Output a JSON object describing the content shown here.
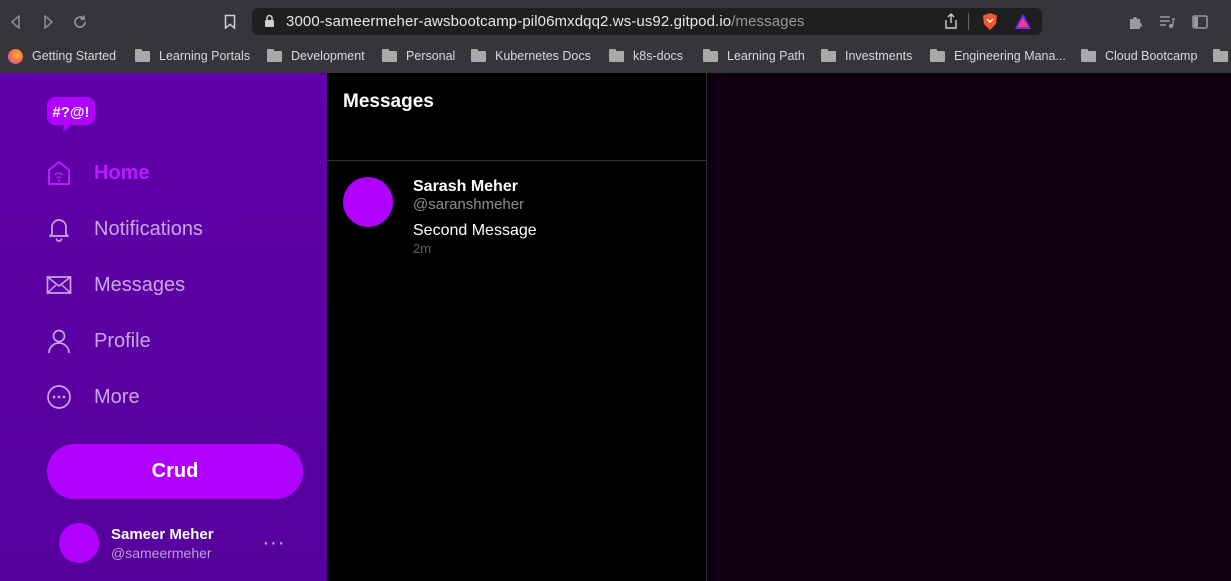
{
  "browser": {
    "url_host": "3000-sameermeher-awsbootcamp-pil06mxdqq2.ws-us92.gitpod.io",
    "url_path": "/messages",
    "bookmarks": [
      "Getting Started",
      "Learning Portals",
      "Development",
      "Personal",
      "Kubernetes Docs",
      "k8s-docs",
      "Learning Path",
      "Investments",
      "Engineering Mana...",
      "Cloud Bootcamp"
    ]
  },
  "logo": {
    "text": "#?@!",
    "color": "#b000ff"
  },
  "sidebar": {
    "items": [
      {
        "label": "Home",
        "icon": "home-icon",
        "active": true
      },
      {
        "label": "Notifications",
        "icon": "bell-icon",
        "active": false
      },
      {
        "label": "Messages",
        "icon": "mail-icon",
        "active": false
      },
      {
        "label": "Profile",
        "icon": "person-icon",
        "active": false
      },
      {
        "label": "More",
        "icon": "more-circle-icon",
        "active": false
      }
    ],
    "crud_label": "Crud",
    "profile": {
      "name": "Sameer Meher",
      "handle": "@sameermeher",
      "more": "···"
    }
  },
  "messages": {
    "title": "Messages",
    "items": [
      {
        "name": "Sarash Meher",
        "handle": "@saranshmeher",
        "text": "Second Message",
        "time": "2m"
      }
    ]
  },
  "colors": {
    "accent": "#b000ff",
    "sidebar_bg": "#5c00a3",
    "page_bg": "#110010"
  }
}
